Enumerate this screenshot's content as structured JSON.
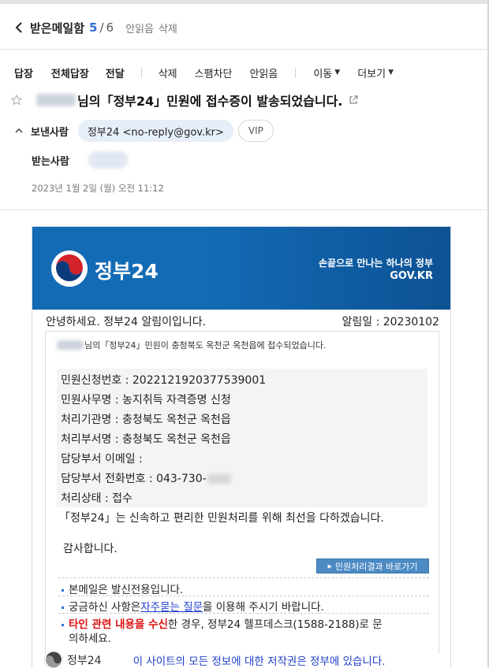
{
  "header": {
    "folder": "받은메일함",
    "current": "5",
    "separator": "/",
    "total": "6",
    "action_unread": "안읽음",
    "action_delete": "삭제"
  },
  "toolbar": {
    "reply": "답장",
    "reply_all": "전체답장",
    "forward": "전달",
    "delete": "삭제",
    "block_spam": "스팸차단",
    "mark_unread": "안읽음",
    "move": "이동",
    "more": "더보기"
  },
  "subject": {
    "text": "님의「정부24」민원에 접수증이 발송되었습니다."
  },
  "meta": {
    "sender_label": "보낸사람",
    "sender": "정부24 <no-reply@gov.kr>",
    "vip": "VIP",
    "receiver_label": "받는사람",
    "date": "2023년 1월 2일 (월) 오전 11:12"
  },
  "mail": {
    "brand": "정부24",
    "slogan": "손끝으로 만나는 하나의 정부",
    "domain": "GOV.KR",
    "greeting": "안녕하세요. 정부24 알림이입니다.",
    "notice_date": "알림일 : 20230102",
    "intro": "님의「정부24」민원이 충청북도 옥천군 옥천읍에 접수되었습니다.",
    "fields": {
      "app_no": "민원신청번호 : 2022121920377539001",
      "affair": "민원사무명 : 농지취득 자격증명 신청",
      "org": "처리기관명 : 충청북도 옥천군 옥천읍",
      "dept": "처리부서명 : 충청북도 옥천군 옥천읍",
      "email": "담당부서 이메일 :",
      "phone": "담당부서 전화번호 : 043-730-",
      "status": "처리상태 : 접수"
    },
    "closing": "「정부24」는 신속하고 편리한 민원처리를 위해 최선을 다하겠습니다.",
    "thanks": "감사합니다.",
    "result_button": "민원처리결과 바로가기",
    "notes": {
      "n1": "본메일은 발신전용입니다.",
      "n2_pre": "궁금하신 사항은 ",
      "n2_link": "자주묻는 질문",
      "n2_post": "을 이용해 주시기 바랍니다.",
      "n3_red": "타인 관련 내용을 수신",
      "n3_post": "한 경우, 정부24 헬프데스크(1588-2188)로 문",
      "n3_cont": "의하세요."
    },
    "footer_brand": "정부24",
    "copyright": "이 사이트의 모든 정보에 대한 저작권은 정부에 있습니다."
  },
  "colors": {
    "accent": "#2f6fd6",
    "banner": "#136bb5",
    "link": "#1f3fc9",
    "warning": "#dd1111"
  },
  "icons": [
    "chevron-left-icon",
    "star-icon",
    "external-link-icon",
    "chevron-up-icon",
    "caret-down-icon",
    "gov-taegeuk-logo"
  ]
}
